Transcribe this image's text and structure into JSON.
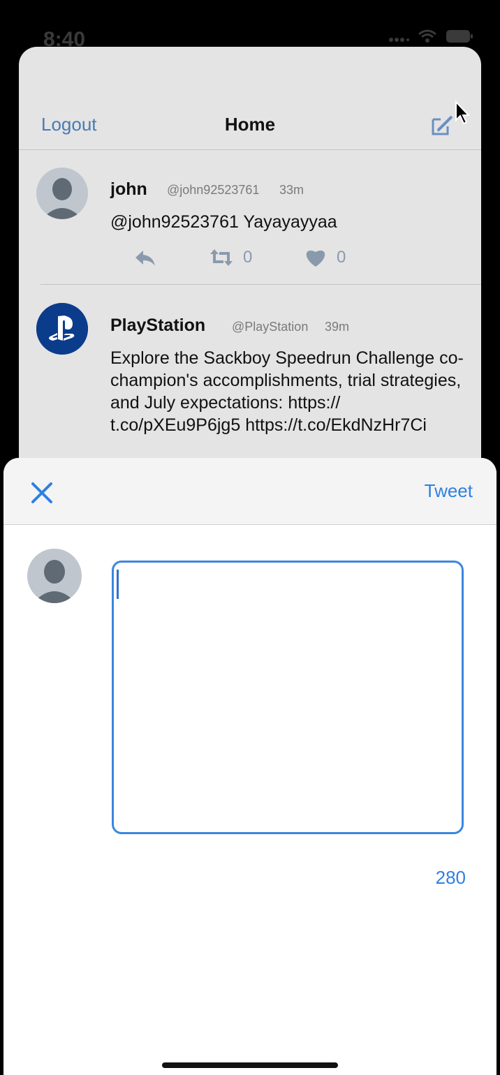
{
  "status_bar": {
    "time": "8:40"
  },
  "nav": {
    "logout_label": "Logout",
    "title": "Home"
  },
  "tweets": [
    {
      "name": "john",
      "handle": "@john92523761",
      "time": "33m",
      "text": "@john92523761 Yayayayyaa",
      "retweets": "0",
      "likes": "0"
    },
    {
      "name": "PlayStation",
      "handle": "@PlayStation",
      "time": "39m",
      "text": "Explore the Sackboy Speedrun Challenge co-champion's accomplishments, trial strategies, and July expectations: https:// t.co/pXEu9P6jg5 https://t.co/EkdNzHr7Ci"
    }
  ],
  "compose": {
    "tweet_label": "Tweet",
    "char_count": "280",
    "input_value": ""
  },
  "colors": {
    "accent": "#2f80e0",
    "nav_link": "#4a7ab3",
    "playstation_blue": "#0b3c8c"
  }
}
